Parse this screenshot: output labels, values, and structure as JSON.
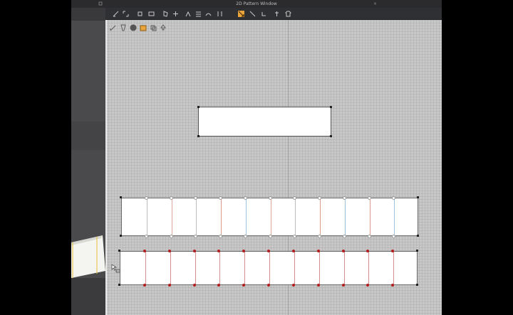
{
  "window": {
    "title": "2D Pattern Window",
    "close_glyph": "×"
  },
  "toolbar": {
    "icons": [
      "transform-pattern-icon",
      "edit-point-icon",
      "add-point-icon",
      "rectangle-icon",
      "polygon-icon",
      "internal-shape-icon",
      "dart-icon",
      "pleat-icon",
      "seam-icon",
      "segment-sewing-icon",
      "free-sewing-icon",
      "fold-icon",
      "tack-icon",
      "pin-icon",
      "avatar-icon"
    ],
    "active_index": 10
  },
  "subtools": {
    "icons": [
      "select-icon",
      "brush-icon",
      "grading-icon",
      "texture-icon",
      "copy-icon",
      "upload-icon"
    ],
    "active_index": 3
  },
  "strip1": {
    "panels": 12,
    "divider_colors": [
      "#d9a99a",
      "#bdbdbd",
      "#d9a99a",
      "#bdbdbd",
      "#d99c8c",
      "#9ec1dc",
      "#d9a99a",
      "#bdbdbd",
      "#d99c8c",
      "#9ec1dc",
      "#d99c8c",
      "#9ec1dc"
    ]
  },
  "strip2": {
    "panels": 12,
    "divider_color": "#d58c8c"
  },
  "colors": {
    "accent": "#e9a53a",
    "seam_red": "#b21c1c"
  }
}
